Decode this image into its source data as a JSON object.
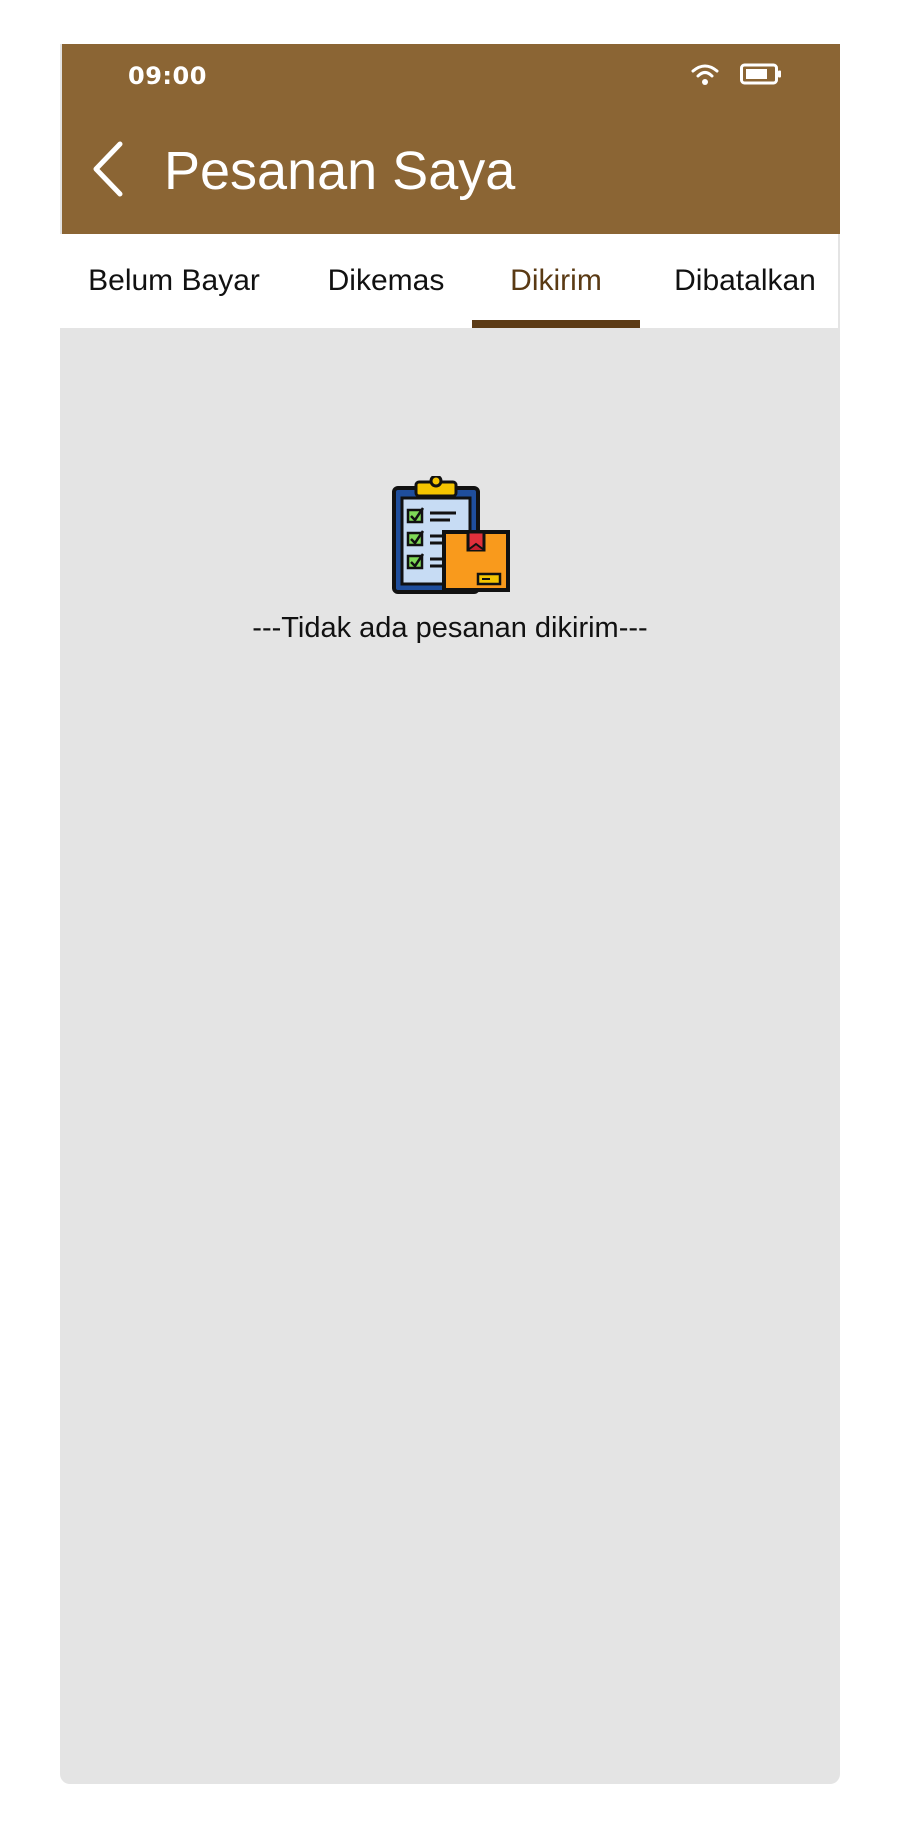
{
  "status_bar": {
    "time": "09:00",
    "icons": [
      "wifi-icon",
      "battery-icon"
    ]
  },
  "header": {
    "title": "Pesanan Saya",
    "back_icon": "chevron-left-icon",
    "background_color": "#8b6534"
  },
  "tabs": [
    {
      "label": "Belum Bayar",
      "active": false
    },
    {
      "label": "Dikemas",
      "active": false
    },
    {
      "label": "Dikirim",
      "active": true
    },
    {
      "label": "Dibatalkan",
      "active": false
    }
  ],
  "empty_state": {
    "icon": "order-checklist-package-icon",
    "message": "---Tidak ada pesanan dikirim---"
  },
  "colors": {
    "accent": "#5c3b16",
    "content_background": "#e4e4e4"
  }
}
